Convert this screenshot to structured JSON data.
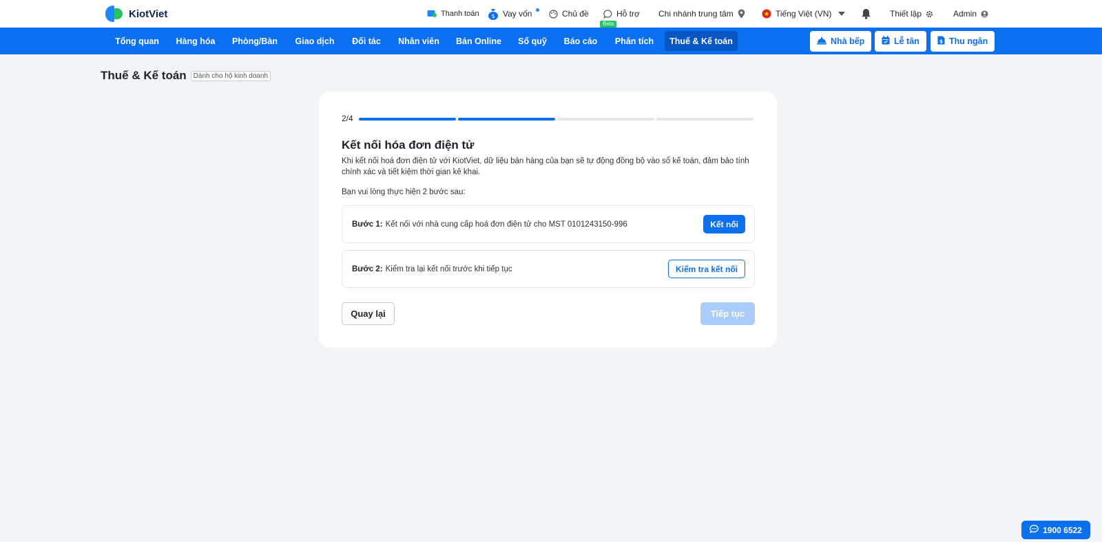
{
  "header": {
    "logo_text": "KiotViet",
    "links": {
      "payment": "Thanh toán",
      "loan": "Vay vốn",
      "theme": "Chủ đề",
      "support": "Hỗ trợ",
      "support_badge": "Beta",
      "branch": "Chi nhánh trung tâm",
      "language": "Tiếng Việt (VN)",
      "settings": "Thiết lập",
      "user": "Admin"
    }
  },
  "nav": {
    "items": [
      {
        "label": "Tổng quan"
      },
      {
        "label": "Hàng hóa"
      },
      {
        "label": "Phòng/Bàn"
      },
      {
        "label": "Giao dịch"
      },
      {
        "label": "Đối tác"
      },
      {
        "label": "Nhân viên"
      },
      {
        "label": "Bán Online"
      },
      {
        "label": "Sổ quỹ"
      },
      {
        "label": "Báo cáo"
      },
      {
        "label": "Phân tích"
      },
      {
        "label": "Thuế & Kế toán"
      }
    ],
    "active_index": 10,
    "buttons": {
      "kitchen": "Nhà bếp",
      "reception": "Lễ tân",
      "cashier": "Thu ngân"
    }
  },
  "page": {
    "title": "Thuế & Kế toán",
    "tag": "Dành cho hộ kinh doanh"
  },
  "wizard": {
    "step_label": "2/4",
    "current_step": 2,
    "total_steps": 4,
    "heading": "Kết nối hóa đơn điện tử",
    "description": "Khi kết nối hoá đơn điện tử với KiotViet, dữ liệu bán hàng của bạn sẽ tự động đồng bộ vào sổ kế toán, đảm bảo tính chính xác và tiết kiệm thời gian kê khai.",
    "instruction": "Bạn vui lòng thực hiện 2 bước sau:",
    "step1": {
      "label": "Bước 1:",
      "text": "Kết nối với nhà cung cấp hoá đơn điện tử cho MST 0101243150-996",
      "button": "Kết nối"
    },
    "step2": {
      "label": "Bước 2:",
      "text": "Kiểm tra lại kết nối trước khi tiếp tục",
      "button": "Kiểm tra kết nối"
    },
    "back_button": "Quay lại",
    "next_button": "Tiếp tục",
    "next_enabled": false
  },
  "hotline": "1900 6522",
  "colors": {
    "primary": "#0a70f0",
    "nav_active": "#0856c4",
    "success": "#22c55e",
    "disabled_button": "#a9ccfa",
    "page_bg": "#f3f4f6"
  }
}
